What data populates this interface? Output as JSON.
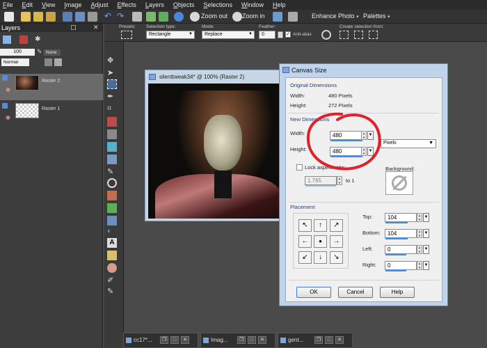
{
  "menubar": {
    "items": [
      "File",
      "Edit",
      "View",
      "Image",
      "Adjust",
      "Effects",
      "Layers",
      "Objects",
      "Selections",
      "Window",
      "Help"
    ]
  },
  "toolbar": {
    "zoom_out_label": "Zoom out",
    "zoom_in_label": "Zoom in",
    "enhance_photo_label": "Enhance Photo",
    "palettes_label": "Palettes"
  },
  "options": {
    "presets_label": "Presets:",
    "selection_type_label": "Selection type:",
    "selection_type_value": "Rectangle",
    "mode_label": "Mode:",
    "mode_value": "Replace",
    "feather_label": "Feather:",
    "feather_value": "0",
    "antialias_label": "Anti-alias",
    "create_selection_label": "Create selection from:"
  },
  "layers": {
    "title": "Layers",
    "opacity": "100",
    "blend_mode": "Normal",
    "none_label": "None",
    "items": [
      {
        "name": "Raster 2"
      },
      {
        "name": "Raster 1"
      }
    ]
  },
  "image_window": {
    "title": "silenttweak34* @ 100% (Raster 2)"
  },
  "dialog": {
    "title": "Canvas Size",
    "original_label": "Original Dimensions",
    "orig_width_label": "Width:",
    "orig_width_value": "480 Pixels",
    "orig_height_label": "Height:",
    "orig_height_value": "272 Pixels",
    "new_label": "New Dimensions",
    "width_label": "Width:",
    "width_value": "480",
    "height_label": "Height:",
    "height_value": "480",
    "units_value": "Pixels",
    "lock_label": "Lock aspect ratio:",
    "ratio_value": "1.765",
    "to1_label": "to 1",
    "background_label": "Background:",
    "placement_label": "Placement",
    "top_label": "Top:",
    "top_value": "104",
    "bottom_label": "Bottom:",
    "bottom_value": "104",
    "left_label": "Left:",
    "left_value": "0",
    "right_label": "Right:",
    "right_value": "0",
    "ok_label": "OK",
    "cancel_label": "Cancel",
    "help_label": "Help"
  },
  "taskbar": {
    "items": [
      "cc17*...",
      "Imag...",
      "gent..."
    ]
  },
  "colors": {
    "annotation": "#e0202a",
    "accent": "#3f8ee6"
  }
}
